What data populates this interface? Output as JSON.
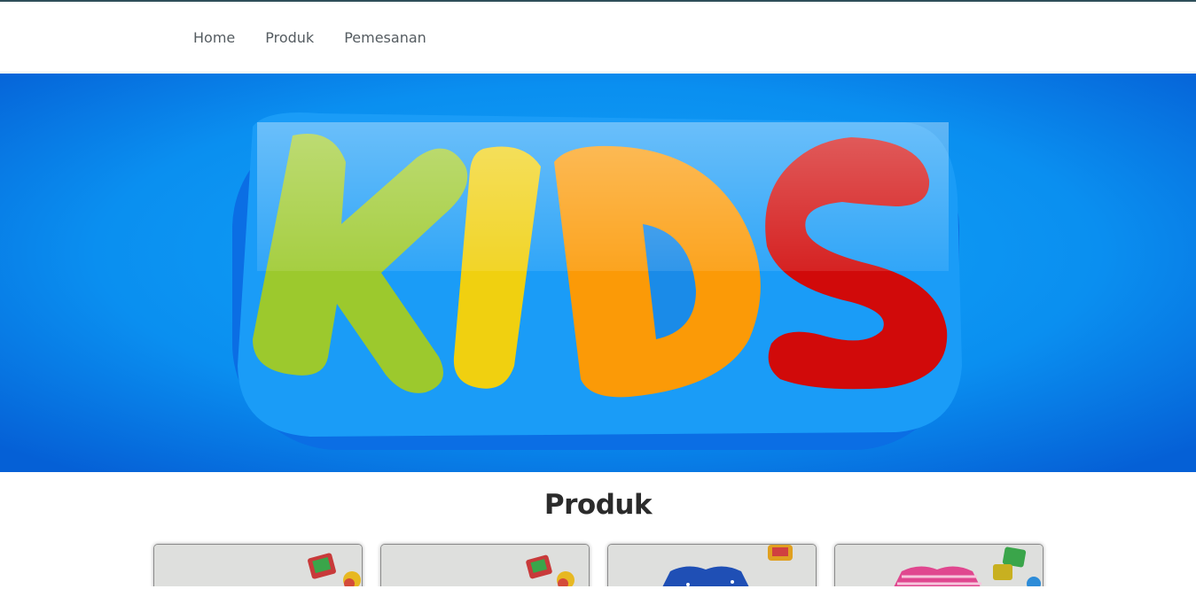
{
  "nav": {
    "items": [
      {
        "label": "Home"
      },
      {
        "label": "Produk"
      },
      {
        "label": "Pemesanan"
      }
    ]
  },
  "hero": {
    "banner_text": "KIDS",
    "colors": {
      "background": "#0a8cf0",
      "outline": "#0f6fe6",
      "k": "#9cc92d",
      "i": "#f0d010",
      "d": "#fb9a07",
      "s": "#d10a0a"
    }
  },
  "products_section": {
    "title": "Produk",
    "cards": [
      {
        "image": "toy-photo"
      },
      {
        "image": "toy-photo"
      },
      {
        "image": "blue-dress-photo"
      },
      {
        "image": "pink-dress-photo"
      }
    ]
  }
}
